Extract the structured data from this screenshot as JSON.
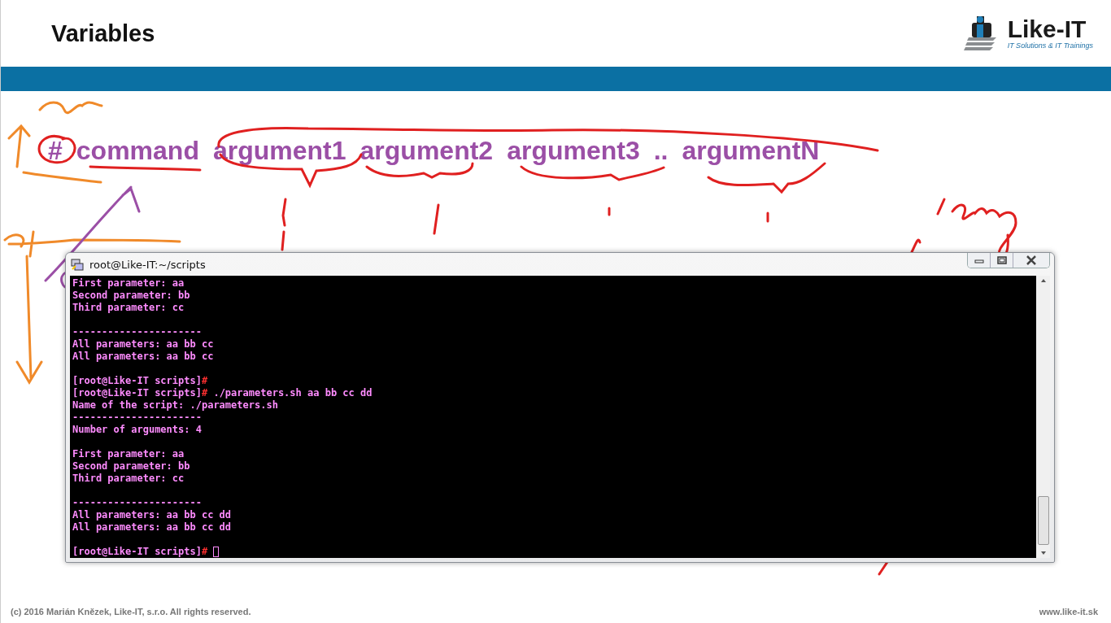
{
  "slide": {
    "title": "Variables",
    "logo": {
      "name": "Like-IT",
      "tagline": "IT Solutions & IT Trainings"
    },
    "syntax": [
      "#",
      "command",
      "argument1",
      "argument2",
      "argument3",
      "..",
      "argumentN"
    ],
    "footer": {
      "copyright": "(c) 2016 Marián Knězek, Like-IT, s.r.o. All rights reserved.",
      "website": "www.like-it.sk"
    }
  },
  "terminal": {
    "title": "root@Like-IT:~/scripts",
    "lines": [
      {
        "kind": "output",
        "text": "First parameter: aa"
      },
      {
        "kind": "output",
        "text": "Second parameter: bb"
      },
      {
        "kind": "output",
        "text": "Third parameter: cc"
      },
      {
        "kind": "blank"
      },
      {
        "kind": "output",
        "text": "----------------------"
      },
      {
        "kind": "output",
        "text": "All parameters: aa bb cc"
      },
      {
        "kind": "output",
        "text": "All parameters: aa bb cc"
      },
      {
        "kind": "blank"
      },
      {
        "kind": "prompt",
        "prompt": "[root@Like-IT scripts]",
        "symbol": "#"
      },
      {
        "kind": "prompt",
        "prompt": "[root@Like-IT scripts]",
        "symbol": "#",
        "command": "./parameters.sh aa bb cc dd"
      },
      {
        "kind": "output",
        "text": "Name of the script: ./parameters.sh"
      },
      {
        "kind": "output",
        "text": "----------------------"
      },
      {
        "kind": "output",
        "text": "Number of arguments: 4"
      },
      {
        "kind": "blank"
      },
      {
        "kind": "output",
        "text": "First parameter: aa"
      },
      {
        "kind": "output",
        "text": "Second parameter: bb"
      },
      {
        "kind": "output",
        "text": "Third parameter: cc"
      },
      {
        "kind": "blank"
      },
      {
        "kind": "output",
        "text": "----------------------"
      },
      {
        "kind": "output",
        "text": "All parameters: aa bb cc dd"
      },
      {
        "kind": "output",
        "text": "All parameters: aa bb cc dd"
      },
      {
        "kind": "blank"
      },
      {
        "kind": "prompt",
        "prompt": "[root@Like-IT scripts]",
        "symbol": "#",
        "cursor": true
      }
    ]
  }
}
